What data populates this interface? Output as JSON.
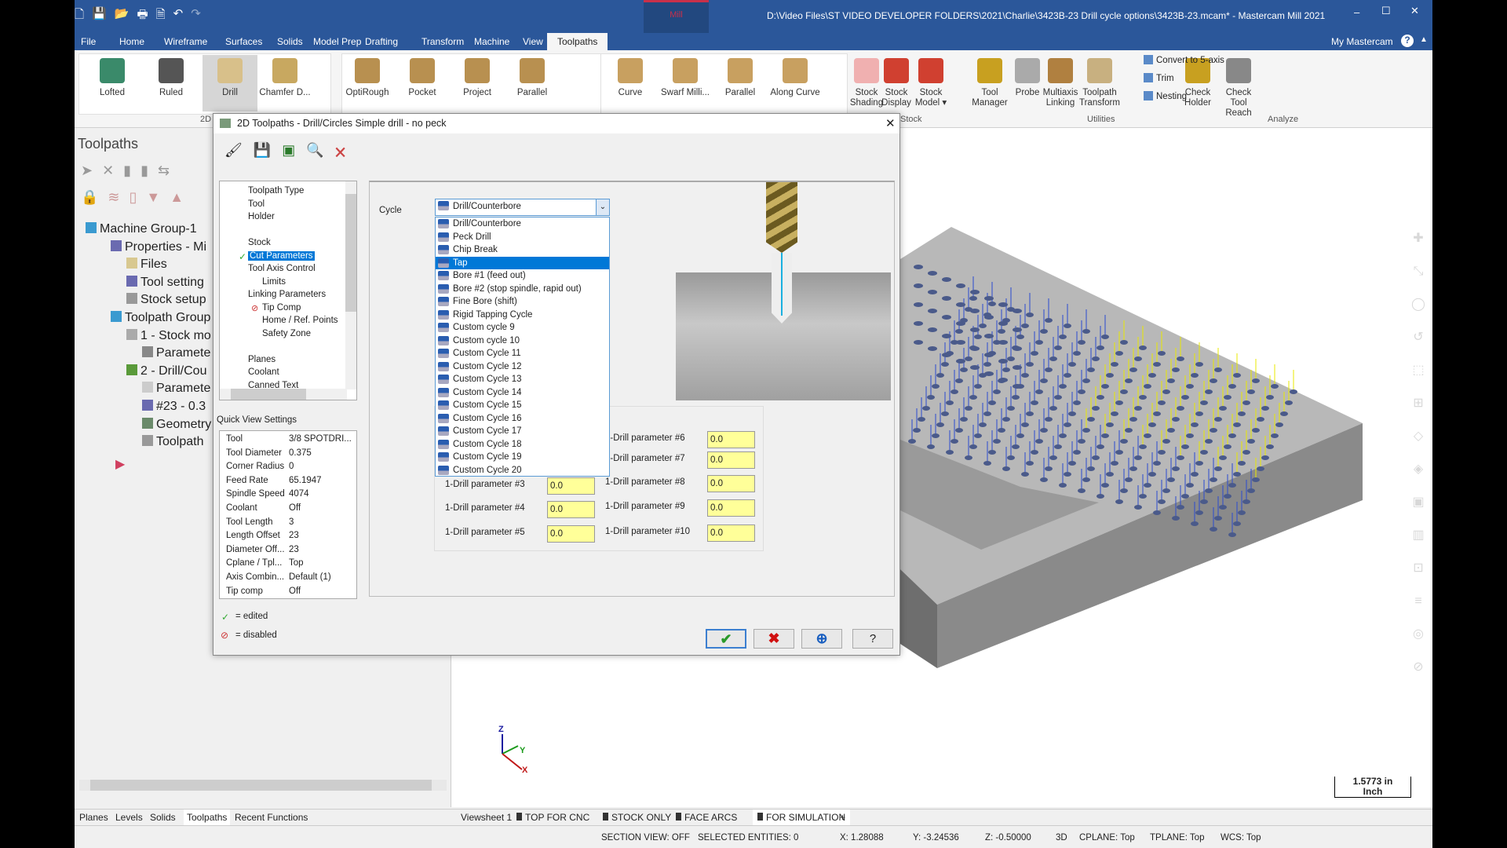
{
  "window": {
    "title": "D:\\Video Files\\ST VIDEO DEVELOPER FOLDERS\\2021\\Charlie\\3423B-23 Drill cycle options\\3423B-23.mcam* - Mastercam Mill 2021",
    "context_tab": "Mill",
    "my_mastercam": "My Mastercam"
  },
  "menu": [
    "File",
    "Home",
    "Wireframe",
    "Surfaces",
    "Solids",
    "Model Prep",
    "Drafting",
    "Transform",
    "Machine",
    "View",
    "Toolpaths"
  ],
  "ribbon": {
    "g1": [
      "Lofted",
      "Ruled",
      "Drill",
      "Chamfer D..."
    ],
    "g2": [
      "OptiRough",
      "Pocket",
      "Project",
      "Parallel"
    ],
    "g3": [
      "Curve",
      "Swarf Milli...",
      "Parallel",
      "Along Curve"
    ],
    "stock": [
      [
        "Stock",
        "Shading"
      ],
      [
        "Stock",
        "Display"
      ],
      [
        "Stock",
        "Model ▾"
      ]
    ],
    "stock_label": "Stock",
    "utilities": [
      [
        "Tool",
        "Manager"
      ],
      [
        "Probe",
        ""
      ],
      [
        "Multiaxis",
        "Linking"
      ],
      [
        "Toolpath",
        "Transform"
      ]
    ],
    "utilities_small": [
      "Convert to 5-axis",
      "Trim",
      "Nesting"
    ],
    "utilities_label": "Utilities",
    "analyze": [
      [
        "Check",
        "Holder"
      ],
      [
        "Check",
        "Tool Reach"
      ]
    ],
    "analyze_label": "Analyze",
    "group_2d": "2D"
  },
  "left": {
    "title": "Toolpaths",
    "tree": [
      {
        "label": "Machine Group-1",
        "indent": 0
      },
      {
        "label": "Properties - Mi",
        "indent": 1
      },
      {
        "label": "Files",
        "indent": 2
      },
      {
        "label": "Tool setting",
        "indent": 2
      },
      {
        "label": "Stock setup",
        "indent": 2
      },
      {
        "label": "Toolpath Group",
        "indent": 1
      },
      {
        "label": "1 - Stock mo",
        "indent": 2
      },
      {
        "label": "Paramete",
        "indent": 3
      },
      {
        "label": "2 - Drill/Cou",
        "indent": 2
      },
      {
        "label": "Paramete",
        "indent": 3
      },
      {
        "label": "#23 - 0.3",
        "indent": 3
      },
      {
        "label": "Geometry",
        "indent": 3
      },
      {
        "label": "Toolpath",
        "indent": 3
      }
    ]
  },
  "dialog": {
    "title": "2D Toolpaths - Drill/Circles Simple drill - no peck",
    "tree": [
      {
        "label": "Toolpath Type",
        "indent": 0
      },
      {
        "label": "Tool",
        "indent": 0
      },
      {
        "label": "Holder",
        "indent": 0
      },
      {
        "label": "",
        "indent": 0
      },
      {
        "label": "Stock",
        "indent": 0
      },
      {
        "label": "Cut Parameters",
        "indent": 0,
        "selected": true,
        "edited": true
      },
      {
        "label": "Tool Axis Control",
        "indent": 0
      },
      {
        "label": "Limits",
        "indent": 1
      },
      {
        "label": "Linking Parameters",
        "indent": 0
      },
      {
        "label": "Tip Comp",
        "indent": 1,
        "disabled": true
      },
      {
        "label": "Home / Ref. Points",
        "indent": 1
      },
      {
        "label": "Safety Zone",
        "indent": 1
      },
      {
        "label": "",
        "indent": 0
      },
      {
        "label": "Planes",
        "indent": 0
      },
      {
        "label": "Coolant",
        "indent": 0
      },
      {
        "label": "Canned Text",
        "indent": 0
      }
    ],
    "cycle_label": "Cycle",
    "cycle_value": "Drill/Counterbore",
    "cycle_options": [
      "Drill/Counterbore",
      "Peck Drill",
      "Chip Break",
      "Tap",
      "Bore #1 (feed out)",
      "Bore #2 (stop spindle, rapid out)",
      "Fine Bore (shift)",
      "Rigid Tapping Cycle",
      "Custom cycle 9",
      "Custom cycle 10",
      "Custom Cycle 11",
      "Custom Cycle 12",
      "Custom Cycle 13",
      "Custom Cycle 14",
      "Custom Cycle 15",
      "Custom Cycle 16",
      "Custom Cycle 17",
      "Custom Cycle 18",
      "Custom Cycle 19",
      "Custom Cycle 20"
    ],
    "highlighted_option": "Tap",
    "params": [
      {
        "label": "1-Drill parameter #3",
        "value": "0.0"
      },
      {
        "label": "1-Drill parameter #4",
        "value": "0.0"
      },
      {
        "label": "1-Drill parameter #5",
        "value": "0.0"
      },
      {
        "label": "1-Drill parameter #6",
        "value": "0.0"
      },
      {
        "label": "1-Drill parameter #7",
        "value": "0.0"
      },
      {
        "label": "1-Drill parameter #8",
        "value": "0.0"
      },
      {
        "label": "1-Drill parameter #9",
        "value": "0.0"
      },
      {
        "label": "1-Drill parameter #10",
        "value": "0.0"
      }
    ],
    "quick_view_title": "Quick View Settings",
    "quick_view": [
      [
        "Tool",
        "3/8 SPOTDRI..."
      ],
      [
        "Tool Diameter",
        "0.375"
      ],
      [
        "Corner Radius",
        "0"
      ],
      [
        "Feed Rate",
        "65.1947"
      ],
      [
        "Spindle Speed",
        "4074"
      ],
      [
        "Coolant",
        "Off"
      ],
      [
        "Tool Length",
        "3"
      ],
      [
        "Length Offset",
        "23"
      ],
      [
        "Diameter Off...",
        "23"
      ],
      [
        "Cplane / Tpl...",
        "Top"
      ],
      [
        "Axis Combin...",
        "Default (1)"
      ],
      [
        "Tip comp",
        "Off"
      ]
    ],
    "legend_edited": "= edited",
    "legend_disabled": "= disabled"
  },
  "bottom_tabs": [
    "Planes",
    "Levels",
    "Solids",
    "Toolpaths",
    "Recent Functions"
  ],
  "viewsheets": [
    "Viewsheet 1",
    "TOP FOR CNC",
    "STOCK ONLY",
    "FACE ARCS",
    "FOR SIMULATION",
    "+"
  ],
  "status": {
    "section": "SECTION VIEW: OFF",
    "selected": "SELECTED ENTITIES: 0",
    "x": "X:  1.28088",
    "y": "Y:  -3.24536",
    "z": "Z:  -0.50000",
    "mode": "3D",
    "cplane": "CPLANE: Top",
    "tplane": "TPLANE: Top",
    "wcs": "WCS: Top"
  },
  "scale": {
    "value": "1.5773 in",
    "unit": "Inch"
  },
  "axes": {
    "z": "Z",
    "y": "Y",
    "x": "X"
  },
  "colors": {
    "titlebar": "#2b579a",
    "selection": "#0078d7",
    "param_field": "#ffff99"
  }
}
